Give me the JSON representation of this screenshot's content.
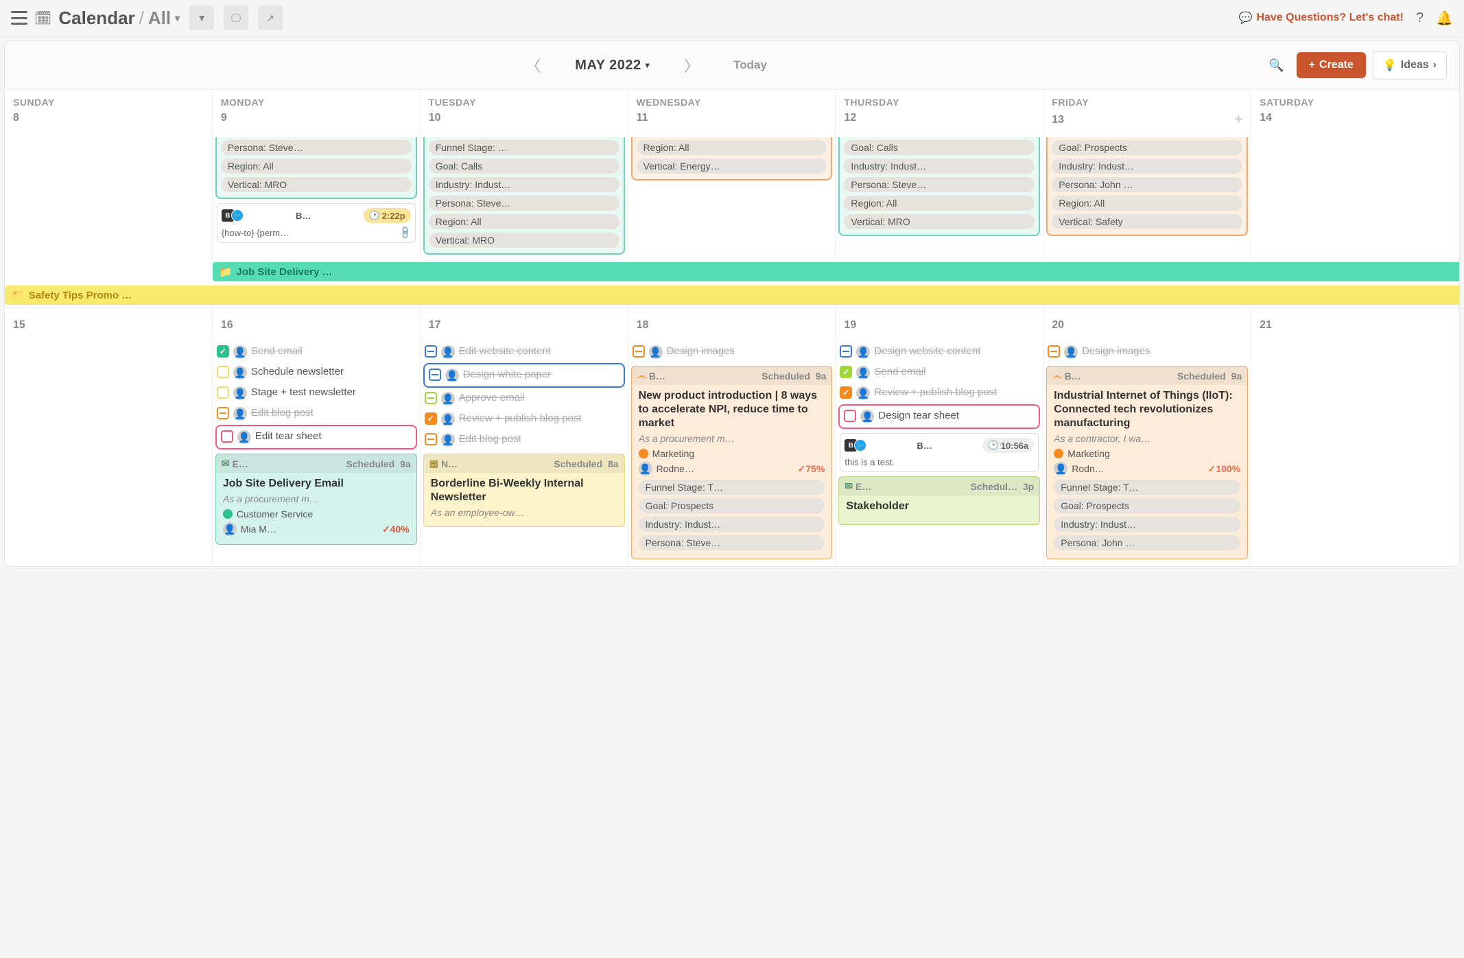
{
  "header": {
    "title": "Calendar",
    "scope": "All",
    "chat": "Have Questions? Let's chat!"
  },
  "nav": {
    "month": "MAY 2022",
    "today": "Today",
    "create": "Create",
    "ideas": "Ideas"
  },
  "week1": {
    "days": [
      {
        "name": "SUNDAY",
        "num": "8"
      },
      {
        "name": "MONDAY",
        "num": "9"
      },
      {
        "name": "TUESDAY",
        "num": "10"
      },
      {
        "name": "WEDNESDAY",
        "num": "11"
      },
      {
        "name": "THURSDAY",
        "num": "12"
      },
      {
        "name": "FRIDAY",
        "num": "13"
      },
      {
        "name": "SATURDAY",
        "num": "14"
      }
    ],
    "mon": {
      "tags": [
        "Persona: Steve…",
        "Region: All",
        "Vertical: MRO"
      ],
      "mini": {
        "label": "B…",
        "time": "2:22p",
        "body": "{how-to} {perm…"
      }
    },
    "tue": {
      "tags": [
        "Funnel Stage: …",
        "Goal: Calls",
        "Industry: Indust…",
        "Persona: Steve…",
        "Region: All",
        "Vertical: MRO"
      ]
    },
    "wed": {
      "tags": [
        "Region: All",
        "Vertical: Energy…"
      ]
    },
    "thu": {
      "tags": [
        "Goal: Calls",
        "Industry: Indust…",
        "Persona: Steve…",
        "Region: All",
        "Vertical: MRO"
      ]
    },
    "fri": {
      "tags": [
        "Goal: Prospects",
        "Industry: Indust…",
        "Persona: John …",
        "Region: All",
        "Vertical: Safety"
      ]
    }
  },
  "spans": {
    "job": "Job Site Delivery …",
    "safety": "Safety Tips Promo …"
  },
  "week2": {
    "days": [
      {
        "num": "15"
      },
      {
        "num": "16"
      },
      {
        "num": "17"
      },
      {
        "num": "18"
      },
      {
        "num": "19"
      },
      {
        "num": "20"
      },
      {
        "num": "21"
      }
    ],
    "mon": {
      "tasks": [
        {
          "chk": "done-green",
          "avatar": true,
          "text": "Send email",
          "done": true
        },
        {
          "chk": "open-yellow",
          "avatar": true,
          "text": "Schedule newsletter"
        },
        {
          "chk": "open-yellow",
          "avatar": true,
          "text": "Stage + test newsletter"
        },
        {
          "chk": "open-orange dash",
          "avatar": true,
          "text": "Edit blog post",
          "done": true
        },
        {
          "chk": "open-red",
          "avatar": true,
          "text": "Edit tear sheet",
          "boxed": true
        }
      ],
      "card": {
        "type": "email",
        "head_l": "E…",
        "head_r": "Scheduled",
        "time": "9a",
        "title": "Job Site Delivery Email",
        "sub": "As a procurement m…",
        "cat": "Customer Service",
        "person": "Mia M…",
        "pct": "40%"
      }
    },
    "tue": {
      "tasks": [
        {
          "chk": "open-blue dash",
          "avatar": true,
          "text": "Edit website content",
          "done": true
        },
        {
          "chk": "open-blue dash",
          "avatar": true,
          "text": "Design white paper",
          "done": true,
          "boxed": "blue"
        },
        {
          "chk": "open-green dash",
          "avatar": true,
          "text": "Approve email",
          "done": true
        },
        {
          "chk": "done-orange",
          "avatar": true,
          "text": "Review + publish blog post",
          "done": true
        },
        {
          "chk": "open-orange dash",
          "avatar": true,
          "text": "Edit blog post",
          "done": true
        }
      ],
      "card": {
        "type": "news",
        "head_l": "N…",
        "head_r": "Scheduled",
        "time": "8a",
        "title": "Borderline Bi-Weekly Internal Newsletter",
        "sub": "As an employee-ow…"
      }
    },
    "wed": {
      "tasks": [
        {
          "chk": "open-orange dash",
          "avatar": true,
          "text": "Design images",
          "done": true
        }
      ],
      "card": {
        "type": "blog",
        "head_l": "B…",
        "head_r": "Scheduled",
        "time": "9a",
        "title": "New product introduction | 8 ways to accelerate NPI, reduce time to market",
        "sub": "As a procurement m…",
        "cat": "Marketing",
        "person": "Rodne…",
        "pct": "75%",
        "tags": [
          "Funnel Stage: T…",
          "Goal: Prospects",
          "Industry: Indust…",
          "Persona: Steve…"
        ]
      }
    },
    "thu": {
      "tasks": [
        {
          "chk": "open-blue dash",
          "avatar": true,
          "text": "Design website content",
          "done": true
        },
        {
          "chk": "done-lime",
          "avatar": true,
          "text": "Send email",
          "done": true
        },
        {
          "chk": "done-orange",
          "avatar": true,
          "text": "Review + publish blog post",
          "done": true
        },
        {
          "chk": "open-red",
          "avatar": true,
          "text": "Design tear sheet",
          "boxed": true
        }
      ],
      "mini": {
        "label": "B…",
        "time": "10:56a",
        "body": "this is a test."
      },
      "card": {
        "type": "email",
        "head_l": "E…",
        "head_r": "Schedul…",
        "time": "3p",
        "title": "Stakeholder"
      }
    },
    "fri": {
      "tasks": [
        {
          "chk": "open-orange dash",
          "avatar": true,
          "text": "Design images",
          "done": true
        }
      ],
      "card": {
        "type": "blog",
        "head_l": "B…",
        "head_r": "Scheduled",
        "time": "9a",
        "title": "Industrial Internet of Things (IIoT): Connected tech revolutionizes manufacturing",
        "sub": "As a contractor, I wa…",
        "cat": "Marketing",
        "person": "Rodn…",
        "pct": "100%",
        "tags": [
          "Funnel Stage: T…",
          "Goal: Prospects",
          "Industry: Indust…",
          "Persona: John …"
        ]
      }
    }
  }
}
